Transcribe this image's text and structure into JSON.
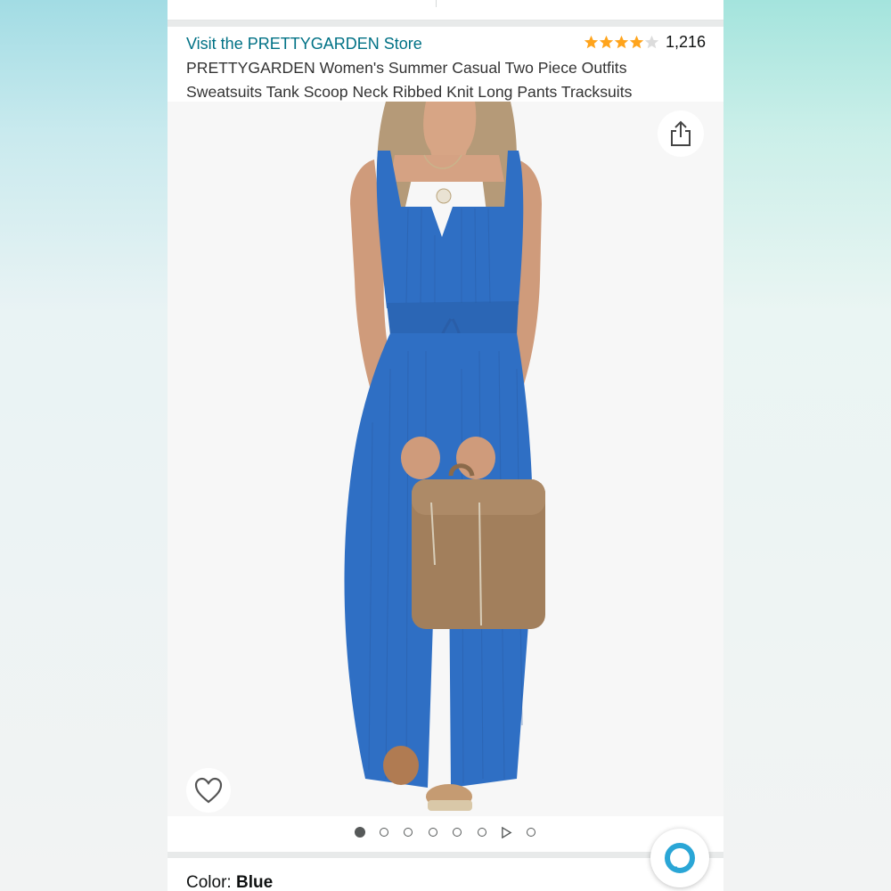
{
  "store": {
    "link_text": "Visit the PRETTYGARDEN Store",
    "link_color": "#007185"
  },
  "rating": {
    "stars": 4,
    "max_stars": 5,
    "review_count": "1,216",
    "star_color": "#ffa41c"
  },
  "product": {
    "title": "PRETTYGARDEN Women's Summer Casual Two Piece Outfits Sweatsuits Tank Scoop Neck Ribbed Knit Long Pants Tracksuits"
  },
  "image": {
    "share_icon": "share-icon",
    "favorite_icon": "heart-icon",
    "outfit_color": "#2f6fc4",
    "bag_color": "#a27f5c"
  },
  "carousel": {
    "image_count": 6,
    "active_index": 0,
    "has_video": true,
    "trailing_count": 1
  },
  "variation": {
    "label": "Color: ",
    "value": "Blue"
  },
  "assistant": {
    "icon": "alexa-icon"
  }
}
